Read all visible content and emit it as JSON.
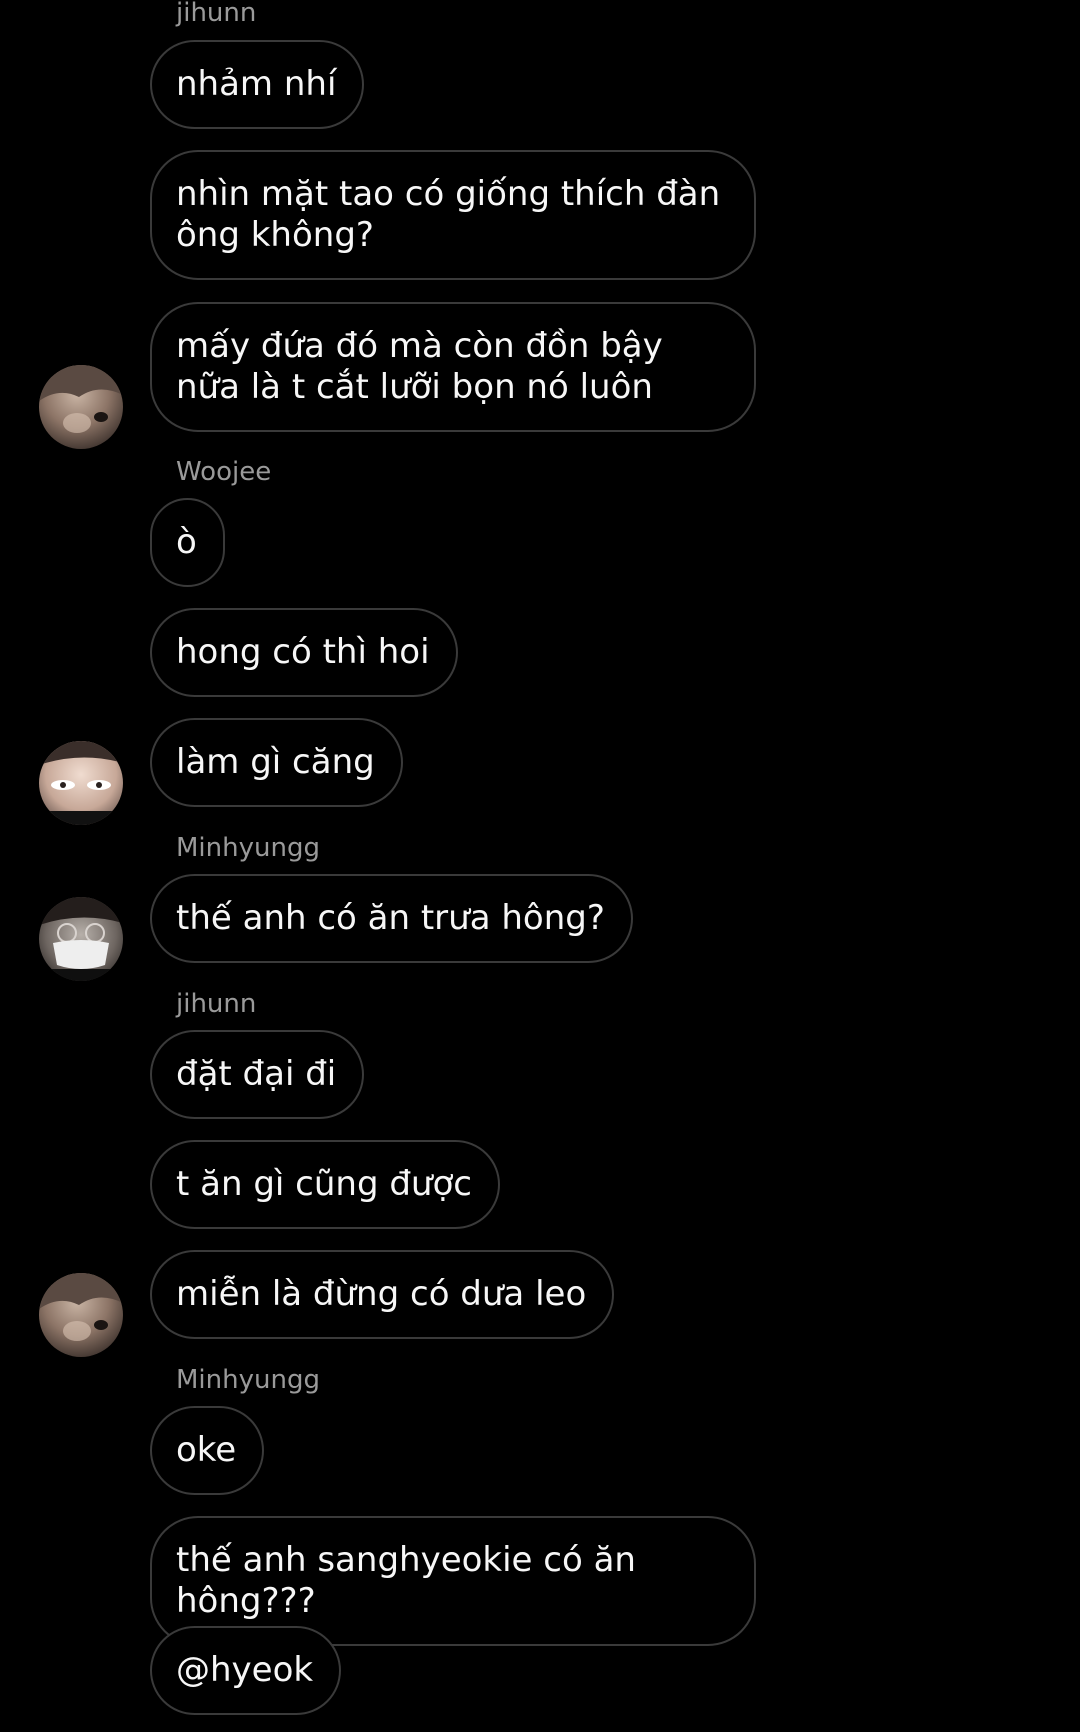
{
  "groups": [
    {
      "sender": "jihunn",
      "messages": [
        "nhảm nhí",
        "nhìn mặt tao có giống thích đàn ông không?",
        "mấy đứa đó mà còn đồn bậy nữa là t cắt lưỡi bọn nó luôn"
      ]
    },
    {
      "sender": "Woojee",
      "messages": [
        "ò",
        "hong có thì hoi",
        "làm gì căng"
      ]
    },
    {
      "sender": "Minhyungg",
      "messages": [
        "thế anh có ăn trưa hông?"
      ]
    },
    {
      "sender": "jihunn",
      "messages": [
        "đặt đại đi",
        "t ăn gì cũng được",
        "miễn là đừng có dưa leo"
      ]
    },
    {
      "sender": "Minhyungg",
      "messages": [
        "oke",
        "thế anh sanghyeokie có ăn hông???",
        "@hyeok"
      ]
    }
  ]
}
